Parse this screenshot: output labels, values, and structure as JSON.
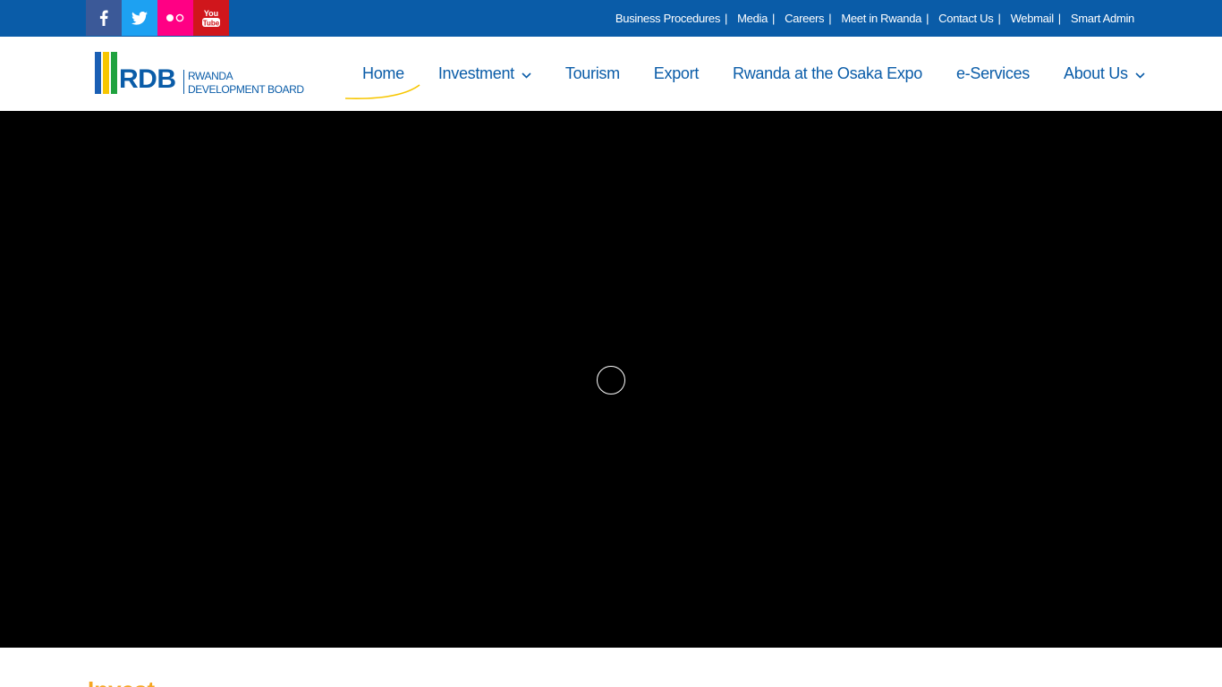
{
  "social": [
    {
      "name": "facebook",
      "icon": "facebook-icon",
      "color": "#3b5998"
    },
    {
      "name": "twitter",
      "icon": "twitter-icon",
      "color": "#1da1f2"
    },
    {
      "name": "flickr",
      "icon": "flickr-icon",
      "color": "#ff0084"
    },
    {
      "name": "youtube",
      "icon": "youtube-icon",
      "color": "#d0161c",
      "label": "You Tube"
    }
  ],
  "top_links": [
    {
      "label": "Business Procedures"
    },
    {
      "label": "Media"
    },
    {
      "label": "Careers"
    },
    {
      "label": "Meet in Rwanda"
    },
    {
      "label": "Contact Us"
    },
    {
      "label": "Webmail"
    },
    {
      "label": "Smart Admin"
    }
  ],
  "top_link_separator": "|",
  "logo": {
    "acronym": "RDB",
    "line1": "RWANDA",
    "line2": "DEVELOPMENT BOARD"
  },
  "nav": {
    "items": [
      {
        "label": "Home",
        "active": true
      },
      {
        "label": "Investment",
        "dropdown": true
      },
      {
        "label": "Tourism"
      },
      {
        "label": "Export"
      },
      {
        "label": "Rwanda at the Osaka Expo"
      },
      {
        "label": "e-Services"
      },
      {
        "label": "About Us",
        "dropdown": true
      }
    ]
  },
  "hero": {
    "loading_icon": "loading-spinner-icon"
  },
  "section": {
    "title": "Invest"
  },
  "colors": {
    "brand_blue": "#0a5ca8",
    "accent_yellow": "#f7c600",
    "accent_orange": "#f5a623",
    "hero_bg": "#000000"
  }
}
